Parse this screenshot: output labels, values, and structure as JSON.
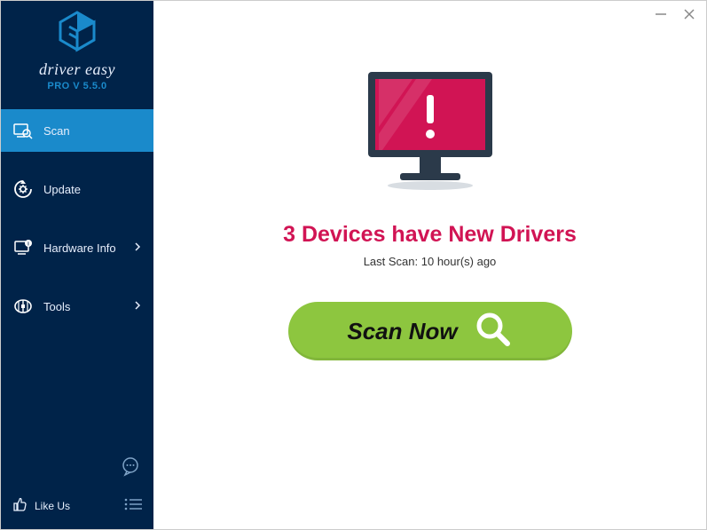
{
  "branding": {
    "title": "driver easy",
    "version": "PRO V 5.5.0"
  },
  "sidebar": {
    "items": [
      {
        "label": "Scan",
        "has_submenu": false
      },
      {
        "label": "Update",
        "has_submenu": false
      },
      {
        "label": "Hardware Info",
        "has_submenu": true
      },
      {
        "label": "Tools",
        "has_submenu": true
      }
    ],
    "like_label": "Like Us"
  },
  "main": {
    "status_text": "3 Devices have New Drivers",
    "last_scan_text": "Last Scan: 10 hour(s) ago",
    "scan_button_label": "Scan Now"
  },
  "colors": {
    "sidebar_bg": "#002349",
    "sidebar_active": "#1a8acb",
    "alert": "#d11454",
    "scan_button": "#8dc63f"
  }
}
